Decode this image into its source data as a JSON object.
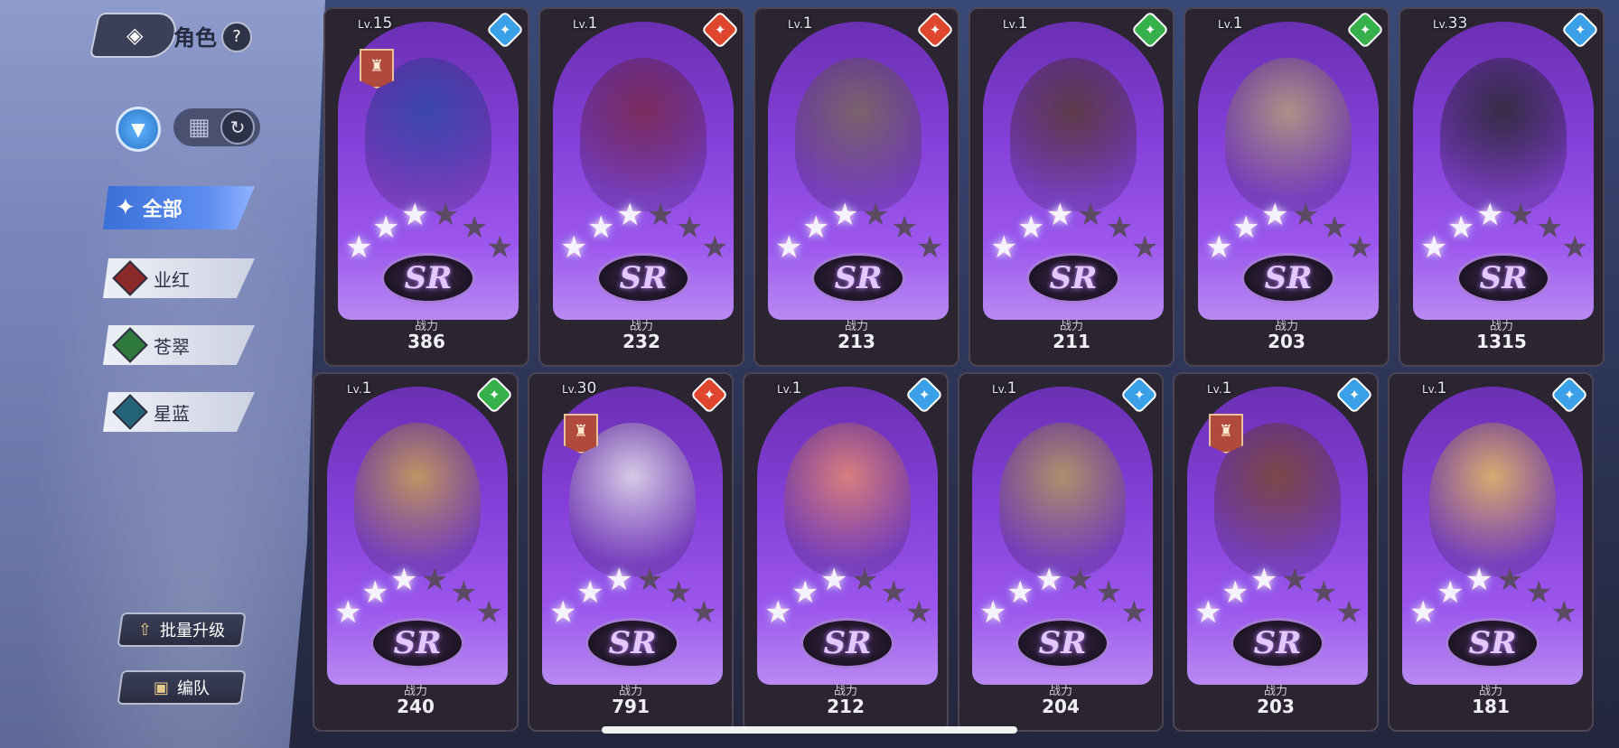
{
  "header": {
    "title": "角色",
    "back_icon": "back-icon",
    "help": "?"
  },
  "controls": {
    "filter_icon": "filter-icon",
    "grid_icon": "grid-icon",
    "refresh_icon": "refresh-icon"
  },
  "categories": [
    {
      "label": "全部",
      "active": true,
      "color": "#5e8ff0"
    },
    {
      "label": "业红",
      "active": false,
      "color": "#8a2a2a"
    },
    {
      "label": "苍翠",
      "active": false,
      "color": "#2e7a3a"
    },
    {
      "label": "星蓝",
      "active": false,
      "color": "#24637a"
    }
  ],
  "buttons": {
    "batch_upgrade": "批量升级",
    "formation": "编队"
  },
  "power_label": "战力",
  "rarity_label": "SR",
  "lv_prefix": "Lv.",
  "cards": [
    {
      "level": "15",
      "power": "386",
      "element": "#3aa0e8",
      "lit_stars": 3,
      "badge": true,
      "portrait": "#2f4aa8"
    },
    {
      "level": "1",
      "power": "232",
      "element": "#e0452e",
      "lit_stars": 3,
      "badge": false,
      "portrait": "#7a2a4a"
    },
    {
      "level": "1",
      "power": "213",
      "element": "#e0452e",
      "lit_stars": 3,
      "badge": false,
      "portrait": "#7a6a5a"
    },
    {
      "level": "1",
      "power": "211",
      "element": "#36b04a",
      "lit_stars": 3,
      "badge": false,
      "portrait": "#5a3a32"
    },
    {
      "level": "1",
      "power": "203",
      "element": "#36b04a",
      "lit_stars": 3,
      "badge": false,
      "portrait": "#b8a07a"
    },
    {
      "level": "33",
      "power": "1315",
      "element": "#3aa0e8",
      "lit_stars": 3,
      "badge": false,
      "portrait": "#2a2a2e"
    },
    {
      "level": "1",
      "power": "240",
      "element": "#36b04a",
      "lit_stars": 3,
      "badge": false,
      "portrait": "#c9a450"
    },
    {
      "level": "30",
      "power": "791",
      "element": "#e0452e",
      "lit_stars": 3,
      "badge": true,
      "portrait": "#e6e2ea"
    },
    {
      "level": "1",
      "power": "212",
      "element": "#3aa0e8",
      "lit_stars": 3,
      "badge": false,
      "portrait": "#e88a70"
    },
    {
      "level": "1",
      "power": "204",
      "element": "#3aa0e8",
      "lit_stars": 3,
      "badge": false,
      "portrait": "#b8a05a"
    },
    {
      "level": "1",
      "power": "203",
      "element": "#3aa0e8",
      "lit_stars": 3,
      "badge": true,
      "portrait": "#7a4a30"
    },
    {
      "level": "1",
      "power": "181",
      "element": "#3aa0e8",
      "lit_stars": 3,
      "badge": false,
      "portrait": "#e8c060"
    }
  ]
}
